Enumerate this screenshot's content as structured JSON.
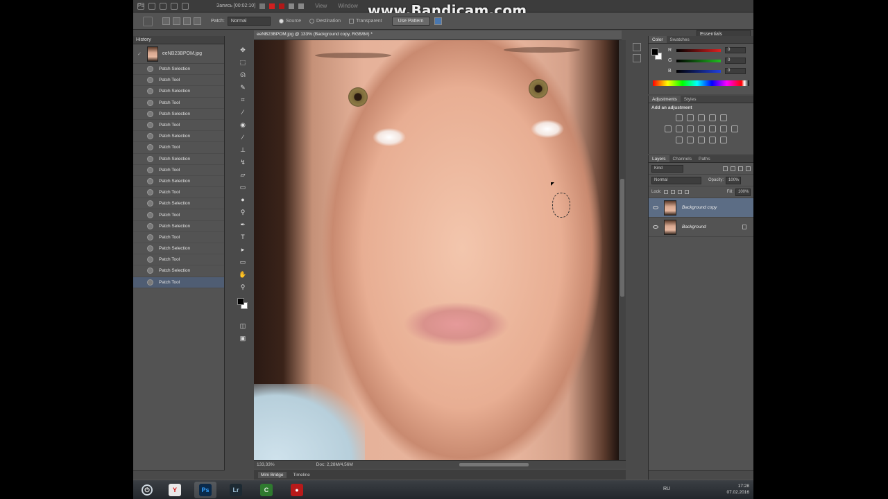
{
  "overlay": {
    "watermark": "www.Bandicam.com"
  },
  "menubar": {
    "recorder_text": "Запись [00:02:10]",
    "menus": [
      "View",
      "Window"
    ]
  },
  "options": {
    "patch_label": "Patch:",
    "patch_mode": "Normal",
    "source_label": "Source",
    "destination_label": "Destination",
    "transparent_label": "Transparent",
    "use_pattern_label": "Use Pattern",
    "workspace": "Essentials"
  },
  "history": {
    "title": "History",
    "snapshot": "eeNB23BPOM.jpg",
    "items": [
      "Patch Selection",
      "Patch Tool",
      "Patch Selection",
      "Patch Tool",
      "Patch Selection",
      "Patch Tool",
      "Patch Selection",
      "Patch Tool",
      "Patch Selection",
      "Patch Tool",
      "Patch Selection",
      "Patch Tool",
      "Patch Selection",
      "Patch Tool",
      "Patch Selection",
      "Patch Tool",
      "Patch Selection",
      "Patch Tool",
      "Patch Selection",
      "Patch Tool"
    ],
    "active_index": 19
  },
  "document": {
    "tab_title": "eeNB23BPOM.jpg @ 133% (Background copy, RGB/8#) *",
    "zoom": "133,33%",
    "doc_size": "Doc: 2,28M/4,56M"
  },
  "bottom_tabs": [
    "Mini Bridge",
    "Timeline"
  ],
  "color_panel": {
    "tabs": [
      "Color",
      "Swatches"
    ],
    "channels": [
      {
        "label": "R",
        "value": "0",
        "color": "#e02020"
      },
      {
        "label": "G",
        "value": "0",
        "color": "#20c020"
      },
      {
        "label": "B",
        "value": "0",
        "color": "#2040e0"
      }
    ]
  },
  "adjustments": {
    "tabs": [
      "Adjustments",
      "Styles"
    ],
    "title": "Add an adjustment"
  },
  "layers": {
    "tabs": [
      "Layers",
      "Channels",
      "Paths"
    ],
    "kind": "Kind",
    "blend_mode": "Normal",
    "opacity_label": "Opacity:",
    "opacity": "100%",
    "lock_label": "Lock:",
    "fill_label": "Fill:",
    "fill": "100%",
    "items": [
      {
        "name": "Background copy",
        "active": true
      },
      {
        "name": "Background",
        "active": false
      }
    ]
  },
  "taskbar": {
    "lang": "RU",
    "time": "17:28",
    "date": "07.02.2016",
    "apps": [
      "Yandex",
      "Ps",
      "Lr",
      "Camtasia",
      "Bandicam"
    ]
  }
}
